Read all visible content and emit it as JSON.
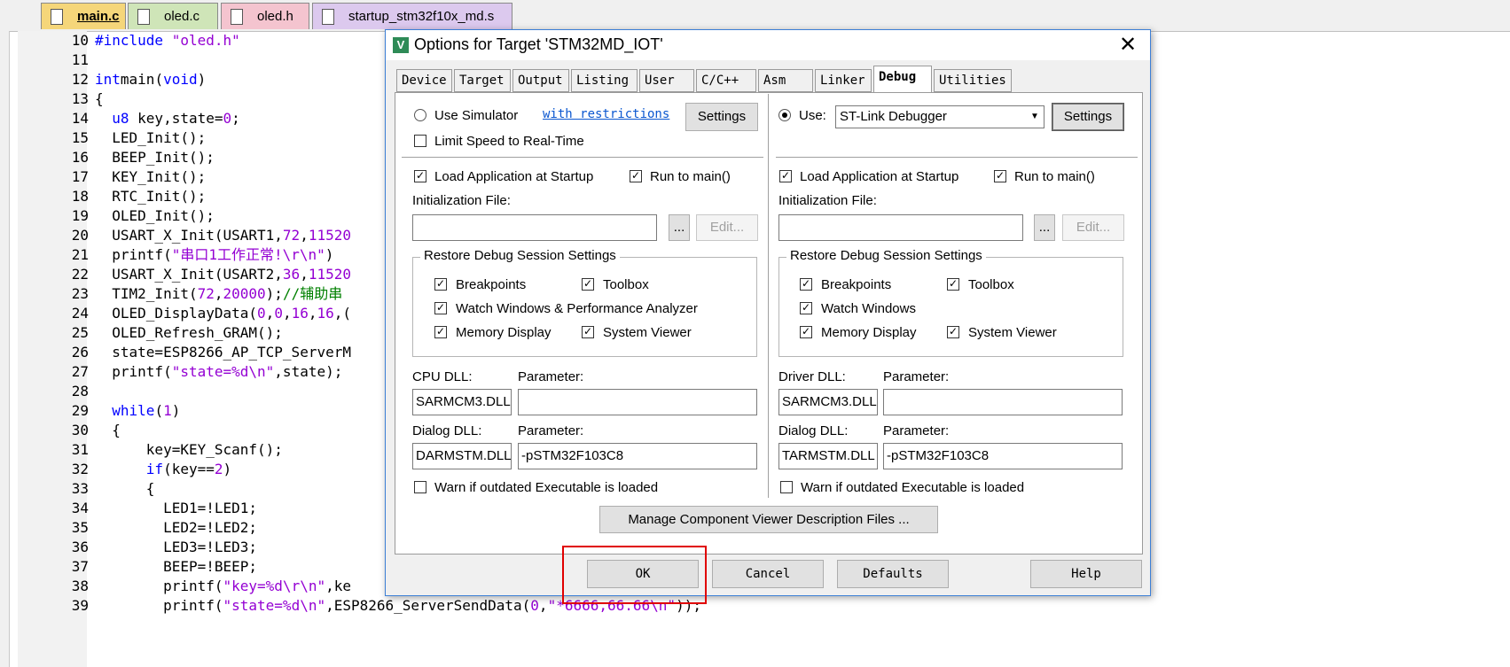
{
  "file_tabs": [
    "main.c",
    "oled.c",
    "oled.h",
    "startup_stm32f10x_md.s"
  ],
  "code_lines": [
    {
      "n": "10",
      "parts": [
        [
          "pp",
          "#include "
        ],
        [
          "str",
          "\"oled.h\""
        ]
      ]
    },
    {
      "n": "11",
      "parts": []
    },
    {
      "n": "12",
      "parts": [
        [
          "kw",
          "int"
        ],
        [
          "",
          "main("
        ],
        [
          "kw",
          "void"
        ],
        [
          "",
          ")"
        ]
      ]
    },
    {
      "n": "13",
      "parts": [
        [
          "",
          "{"
        ]
      ]
    },
    {
      "n": "14",
      "parts": [
        [
          "",
          "  "
        ],
        [
          "kw",
          "u8"
        ],
        [
          "",
          " key,state="
        ],
        [
          "num",
          "0"
        ],
        [
          "",
          ";"
        ]
      ]
    },
    {
      "n": "15",
      "parts": [
        [
          "",
          "  LED_Init();"
        ]
      ]
    },
    {
      "n": "16",
      "parts": [
        [
          "",
          "  BEEP_Init();"
        ]
      ]
    },
    {
      "n": "17",
      "parts": [
        [
          "",
          "  KEY_Init();"
        ]
      ]
    },
    {
      "n": "18",
      "parts": [
        [
          "",
          "  RTC_Init();"
        ]
      ]
    },
    {
      "n": "19",
      "parts": [
        [
          "",
          "  OLED_Init();"
        ]
      ]
    },
    {
      "n": "20",
      "parts": [
        [
          "",
          "  USART_X_Init(USART1,"
        ],
        [
          "num",
          "72"
        ],
        [
          "",
          ","
        ],
        [
          "num",
          "11520"
        ]
      ]
    },
    {
      "n": "21",
      "parts": [
        [
          "",
          "  printf("
        ],
        [
          "str",
          "\"串口1工作正常!\\r\\n\""
        ],
        [
          "",
          ")"
        ]
      ]
    },
    {
      "n": "22",
      "parts": [
        [
          "",
          "  USART_X_Init(USART2,"
        ],
        [
          "num",
          "36"
        ],
        [
          "",
          ","
        ],
        [
          "num",
          "11520"
        ]
      ]
    },
    {
      "n": "23",
      "parts": [
        [
          "",
          "  TIM2_Init("
        ],
        [
          "num",
          "72"
        ],
        [
          "",
          ","
        ],
        [
          "num",
          "20000"
        ],
        [
          "",
          ");"
        ],
        [
          "cmt",
          "//辅助串"
        ]
      ]
    },
    {
      "n": "24",
      "parts": [
        [
          "",
          "  OLED_DisplayData("
        ],
        [
          "num",
          "0"
        ],
        [
          "",
          ","
        ],
        [
          "num",
          "0"
        ],
        [
          "",
          ","
        ],
        [
          "num",
          "16"
        ],
        [
          "",
          ","
        ],
        [
          "num",
          "16"
        ],
        [
          "",
          ",("
        ]
      ]
    },
    {
      "n": "25",
      "parts": [
        [
          "",
          "  OLED_Refresh_GRAM();"
        ]
      ]
    },
    {
      "n": "26",
      "parts": [
        [
          "",
          "  state=ESP8266_AP_TCP_ServerM"
        ]
      ]
    },
    {
      "n": "27",
      "parts": [
        [
          "",
          "  printf("
        ],
        [
          "str",
          "\"state=%d\\n\""
        ],
        [
          "",
          ",state);"
        ]
      ]
    },
    {
      "n": "28",
      "parts": []
    },
    {
      "n": "29",
      "parts": [
        [
          "",
          "  "
        ],
        [
          "kw",
          "while"
        ],
        [
          "",
          "("
        ],
        [
          "num",
          "1"
        ],
        [
          "",
          ")"
        ]
      ]
    },
    {
      "n": "30",
      "parts": [
        [
          "",
          "  {"
        ]
      ]
    },
    {
      "n": "31",
      "parts": [
        [
          "",
          "      key=KEY_Scanf();"
        ]
      ]
    },
    {
      "n": "32",
      "parts": [
        [
          "",
          "      "
        ],
        [
          "kw",
          "if"
        ],
        [
          "",
          "(key=="
        ],
        [
          "num",
          "2"
        ],
        [
          "",
          ")"
        ]
      ]
    },
    {
      "n": "33",
      "parts": [
        [
          "",
          "      {"
        ]
      ]
    },
    {
      "n": "34",
      "parts": [
        [
          "",
          "        LED1=!LED1;"
        ]
      ]
    },
    {
      "n": "35",
      "parts": [
        [
          "",
          "        LED2=!LED2;"
        ]
      ]
    },
    {
      "n": "36",
      "parts": [
        [
          "",
          "        LED3=!LED3;"
        ]
      ]
    },
    {
      "n": "37",
      "parts": [
        [
          "",
          "        BEEP=!BEEP;"
        ]
      ]
    },
    {
      "n": "38",
      "parts": [
        [
          "",
          "        printf("
        ],
        [
          "str",
          "\"key=%d\\r\\n\""
        ],
        [
          "",
          ",ke"
        ]
      ]
    },
    {
      "n": "39",
      "parts": [
        [
          "",
          "        printf("
        ],
        [
          "str",
          "\"state=%d\\n\""
        ],
        [
          "",
          ",ESP8266_ServerSendData("
        ],
        [
          "num",
          "0"
        ],
        [
          "",
          ","
        ],
        [
          "str",
          "\"*6666,66.66\\n\""
        ],
        [
          "",
          "));"
        ]
      ]
    }
  ],
  "dialog": {
    "title": "Options for Target 'STM32MD_IOT'",
    "close": "✕",
    "tabs": [
      "Device",
      "Target",
      "Output",
      "Listing",
      "User",
      "C/C++",
      "Asm",
      "Linker",
      "Debug",
      "Utilities"
    ],
    "selected_tab": "Debug",
    "left": {
      "use_simulator": "Use Simulator",
      "restrictions_link": "with restrictions",
      "settings": "Settings",
      "limit_speed": "Limit Speed to Real-Time",
      "load_app": "Load Application at Startup",
      "run_to_main": "Run to main()",
      "init_file_label": "Initialization File:",
      "browse": "...",
      "edit": "Edit...",
      "restore_group": "Restore Debug Session Settings",
      "breakpoints": "Breakpoints",
      "toolbox": "Toolbox",
      "watch_windows": "Watch Windows & Performance Analyzer",
      "memory_display": "Memory Display",
      "system_viewer": "System Viewer",
      "cpu_dll_label": "CPU DLL:",
      "parameter_label": "Parameter:",
      "cpu_dll_value": "SARMCM3.DLL",
      "cpu_param_value": "",
      "dialog_dll_label": "Dialog DLL:",
      "dialog_dll_value": "DARMSTM.DLL",
      "dialog_param_value": "-pSTM32F103C8",
      "warn": "Warn if outdated Executable is loaded"
    },
    "right": {
      "use": "Use:",
      "debugger": "ST-Link Debugger",
      "settings": "Settings",
      "load_app": "Load Application at Startup",
      "run_to_main": "Run to main()",
      "init_file_label": "Initialization File:",
      "browse": "...",
      "edit": "Edit...",
      "restore_group": "Restore Debug Session Settings",
      "breakpoints": "Breakpoints",
      "toolbox": "Toolbox",
      "watch_windows": "Watch Windows",
      "memory_display": "Memory Display",
      "system_viewer": "System Viewer",
      "driver_dll_label": "Driver DLL:",
      "parameter_label": "Parameter:",
      "driver_dll_value": "SARMCM3.DLL",
      "driver_param_value": "",
      "dialog_dll_label": "Dialog DLL:",
      "dialog_dll_value": "TARMSTM.DLL",
      "dialog_param_value": "-pSTM32F103C8",
      "warn": "Warn if outdated Executable is loaded"
    },
    "manage_button": "Manage Component Viewer Description Files ...",
    "buttons": {
      "ok": "OK",
      "cancel": "Cancel",
      "defaults": "Defaults",
      "help": "Help"
    }
  },
  "colors": {
    "highlight": "#e00000",
    "title_border": "#3c7fd6"
  }
}
